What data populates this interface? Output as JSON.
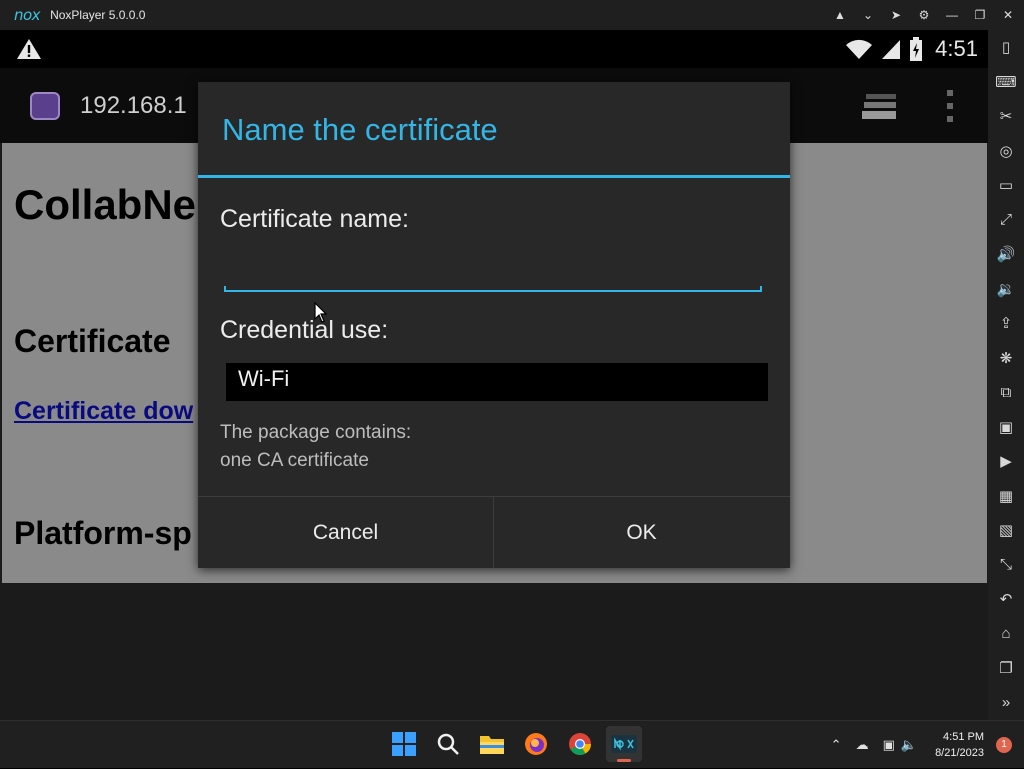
{
  "window": {
    "logo": "nox",
    "title": "NoxPlayer 5.0.0.0"
  },
  "status_bar": {
    "time": "4:51"
  },
  "action_bar": {
    "url": "192.168.1"
  },
  "webpage": {
    "heading": "CollabNe",
    "section_certificate": "Certificate",
    "link_download": "Certificate dow",
    "section_platform": "Platform-sp"
  },
  "dialog": {
    "title": "Name the certificate",
    "name_label": "Certificate name:",
    "name_value": "",
    "use_label": "Credential use:",
    "use_value": "Wi-Fi",
    "package_line1": "The package contains:",
    "package_line2": "one CA certificate",
    "cancel_label": "Cancel",
    "ok_label": "OK"
  },
  "taskbar": {
    "time": "4:51 PM",
    "date": "8/21/2023",
    "notification_count": "1"
  },
  "colors": {
    "accent": "#33b5e5"
  }
}
